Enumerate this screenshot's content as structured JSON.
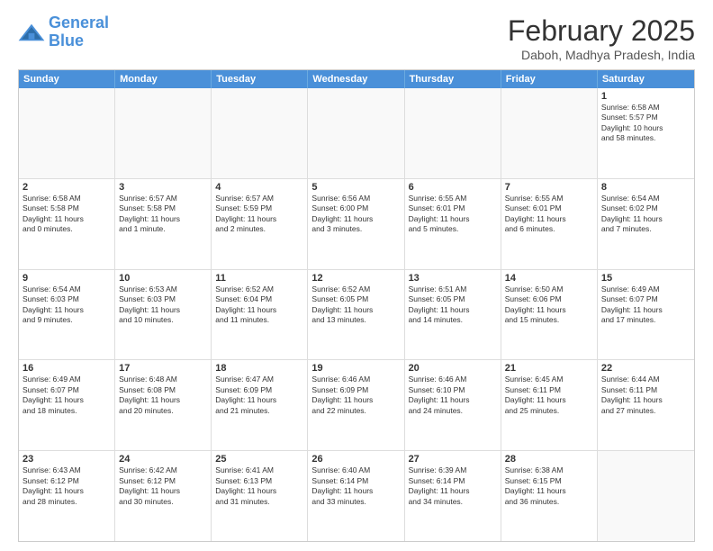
{
  "logo": {
    "line1": "General",
    "line2": "Blue"
  },
  "title": "February 2025",
  "location": "Daboh, Madhya Pradesh, India",
  "weekdays": [
    "Sunday",
    "Monday",
    "Tuesday",
    "Wednesday",
    "Thursday",
    "Friday",
    "Saturday"
  ],
  "rows": [
    [
      {
        "day": "",
        "text": ""
      },
      {
        "day": "",
        "text": ""
      },
      {
        "day": "",
        "text": ""
      },
      {
        "day": "",
        "text": ""
      },
      {
        "day": "",
        "text": ""
      },
      {
        "day": "",
        "text": ""
      },
      {
        "day": "1",
        "text": "Sunrise: 6:58 AM\nSunset: 5:57 PM\nDaylight: 10 hours\nand 58 minutes."
      }
    ],
    [
      {
        "day": "2",
        "text": "Sunrise: 6:58 AM\nSunset: 5:58 PM\nDaylight: 11 hours\nand 0 minutes."
      },
      {
        "day": "3",
        "text": "Sunrise: 6:57 AM\nSunset: 5:58 PM\nDaylight: 11 hours\nand 1 minute."
      },
      {
        "day": "4",
        "text": "Sunrise: 6:57 AM\nSunset: 5:59 PM\nDaylight: 11 hours\nand 2 minutes."
      },
      {
        "day": "5",
        "text": "Sunrise: 6:56 AM\nSunset: 6:00 PM\nDaylight: 11 hours\nand 3 minutes."
      },
      {
        "day": "6",
        "text": "Sunrise: 6:55 AM\nSunset: 6:01 PM\nDaylight: 11 hours\nand 5 minutes."
      },
      {
        "day": "7",
        "text": "Sunrise: 6:55 AM\nSunset: 6:01 PM\nDaylight: 11 hours\nand 6 minutes."
      },
      {
        "day": "8",
        "text": "Sunrise: 6:54 AM\nSunset: 6:02 PM\nDaylight: 11 hours\nand 7 minutes."
      }
    ],
    [
      {
        "day": "9",
        "text": "Sunrise: 6:54 AM\nSunset: 6:03 PM\nDaylight: 11 hours\nand 9 minutes."
      },
      {
        "day": "10",
        "text": "Sunrise: 6:53 AM\nSunset: 6:03 PM\nDaylight: 11 hours\nand 10 minutes."
      },
      {
        "day": "11",
        "text": "Sunrise: 6:52 AM\nSunset: 6:04 PM\nDaylight: 11 hours\nand 11 minutes."
      },
      {
        "day": "12",
        "text": "Sunrise: 6:52 AM\nSunset: 6:05 PM\nDaylight: 11 hours\nand 13 minutes."
      },
      {
        "day": "13",
        "text": "Sunrise: 6:51 AM\nSunset: 6:05 PM\nDaylight: 11 hours\nand 14 minutes."
      },
      {
        "day": "14",
        "text": "Sunrise: 6:50 AM\nSunset: 6:06 PM\nDaylight: 11 hours\nand 15 minutes."
      },
      {
        "day": "15",
        "text": "Sunrise: 6:49 AM\nSunset: 6:07 PM\nDaylight: 11 hours\nand 17 minutes."
      }
    ],
    [
      {
        "day": "16",
        "text": "Sunrise: 6:49 AM\nSunset: 6:07 PM\nDaylight: 11 hours\nand 18 minutes."
      },
      {
        "day": "17",
        "text": "Sunrise: 6:48 AM\nSunset: 6:08 PM\nDaylight: 11 hours\nand 20 minutes."
      },
      {
        "day": "18",
        "text": "Sunrise: 6:47 AM\nSunset: 6:09 PM\nDaylight: 11 hours\nand 21 minutes."
      },
      {
        "day": "19",
        "text": "Sunrise: 6:46 AM\nSunset: 6:09 PM\nDaylight: 11 hours\nand 22 minutes."
      },
      {
        "day": "20",
        "text": "Sunrise: 6:46 AM\nSunset: 6:10 PM\nDaylight: 11 hours\nand 24 minutes."
      },
      {
        "day": "21",
        "text": "Sunrise: 6:45 AM\nSunset: 6:11 PM\nDaylight: 11 hours\nand 25 minutes."
      },
      {
        "day": "22",
        "text": "Sunrise: 6:44 AM\nSunset: 6:11 PM\nDaylight: 11 hours\nand 27 minutes."
      }
    ],
    [
      {
        "day": "23",
        "text": "Sunrise: 6:43 AM\nSunset: 6:12 PM\nDaylight: 11 hours\nand 28 minutes."
      },
      {
        "day": "24",
        "text": "Sunrise: 6:42 AM\nSunset: 6:12 PM\nDaylight: 11 hours\nand 30 minutes."
      },
      {
        "day": "25",
        "text": "Sunrise: 6:41 AM\nSunset: 6:13 PM\nDaylight: 11 hours\nand 31 minutes."
      },
      {
        "day": "26",
        "text": "Sunrise: 6:40 AM\nSunset: 6:14 PM\nDaylight: 11 hours\nand 33 minutes."
      },
      {
        "day": "27",
        "text": "Sunrise: 6:39 AM\nSunset: 6:14 PM\nDaylight: 11 hours\nand 34 minutes."
      },
      {
        "day": "28",
        "text": "Sunrise: 6:38 AM\nSunset: 6:15 PM\nDaylight: 11 hours\nand 36 minutes."
      },
      {
        "day": "",
        "text": ""
      }
    ]
  ]
}
